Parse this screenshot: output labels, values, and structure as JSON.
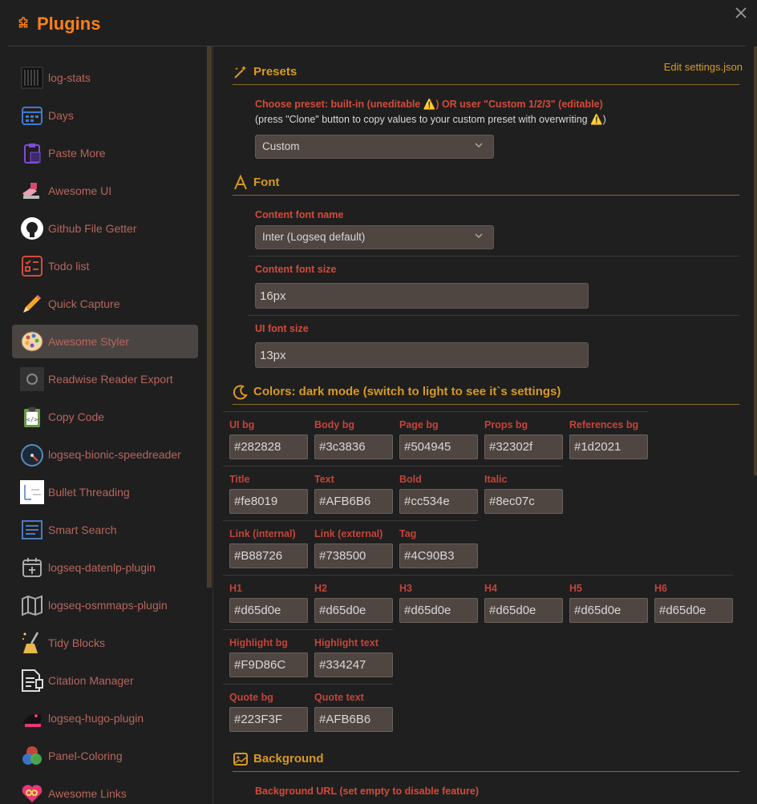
{
  "header": {
    "title": "Plugins",
    "title_icon": "puzzle-icon",
    "close_icon": "close-icon"
  },
  "sidebar": {
    "items": [
      {
        "label": "log-stats",
        "icon": "log-stats-icon"
      },
      {
        "label": "Days",
        "icon": "calendar-icon"
      },
      {
        "label": "Paste More",
        "icon": "paste-icon"
      },
      {
        "label": "Awesome UI",
        "icon": "awesome-ui-icon"
      },
      {
        "label": "Github File Getter",
        "icon": "github-icon"
      },
      {
        "label": "Todo list",
        "icon": "todo-list-icon"
      },
      {
        "label": "Quick Capture",
        "icon": "pencil-icon"
      },
      {
        "label": "Awesome Styler",
        "icon": "palette-icon"
      },
      {
        "label": "Readwise Reader Export",
        "icon": "readwise-icon"
      },
      {
        "label": "Copy Code",
        "icon": "clipboard-code-icon"
      },
      {
        "label": "logseq-bionic-speedreader",
        "icon": "speedometer-icon"
      },
      {
        "label": "Bullet Threading",
        "icon": "bullet-threading-icon"
      },
      {
        "label": "Smart Search",
        "icon": "smart-search-icon"
      },
      {
        "label": "logseq-datenlp-plugin",
        "icon": "calendar-plus-icon"
      },
      {
        "label": "logseq-osmmaps-plugin",
        "icon": "map-icon"
      },
      {
        "label": "Tidy Blocks",
        "icon": "broom-icon"
      },
      {
        "label": "Citation Manager",
        "icon": "citation-icon"
      },
      {
        "label": "logseq-hugo-plugin",
        "icon": "hugo-icon"
      },
      {
        "label": "Panel-Coloring",
        "icon": "color-circles-icon"
      },
      {
        "label": "Awesome Links",
        "icon": "heart-links-icon"
      }
    ]
  },
  "main": {
    "edit_settings": "Edit settings.json",
    "presets": {
      "title": "Presets",
      "label_a": "Choose preset: built-in (uneditable ",
      "label_b": ") OR user \"Custom 1/2/3\" (editable)",
      "desc_a": "(press \"Clone\" button to copy values to your custom preset with overwriting ",
      "desc_b": ")",
      "warning_glyph": "⚠️",
      "selected": "Custom"
    },
    "font": {
      "title": "Font",
      "content_font_name_label": "Content font name",
      "content_font_name_value": "Inter (Logseq default)",
      "content_font_size_label": "Content font size",
      "content_font_size_value": "16px",
      "ui_font_size_label": "UI font size",
      "ui_font_size_value": "13px"
    },
    "colors": {
      "title": "Colors: dark mode (switch to light to see it`s settings)",
      "ui_bg": {
        "label": "UI bg",
        "value": "#282828"
      },
      "body_bg": {
        "label": "Body bg",
        "value": "#3c3836"
      },
      "page_bg": {
        "label": "Page bg",
        "value": "#504945"
      },
      "props_bg": {
        "label": "Props bg",
        "value": "#32302f"
      },
      "references_bg": {
        "label": "References bg",
        "value": "#1d2021"
      },
      "title_c": {
        "label": "Title",
        "value": "#fe8019"
      },
      "text_c": {
        "label": "Text",
        "value": "#AFB6B6"
      },
      "bold_c": {
        "label": "Bold",
        "value": "#cc534e"
      },
      "italic_c": {
        "label": "Italic",
        "value": "#8ec07c"
      },
      "link_int": {
        "label": "Link (internal)",
        "value": "#B88726"
      },
      "link_ext": {
        "label": "Link (external)",
        "value": "#738500"
      },
      "tag": {
        "label": "Tag",
        "value": "#4C90B3"
      },
      "h1": {
        "label": "H1",
        "value": "#d65d0e"
      },
      "h2": {
        "label": "H2",
        "value": "#d65d0e"
      },
      "h3": {
        "label": "H3",
        "value": "#d65d0e"
      },
      "h4": {
        "label": "H4",
        "value": "#d65d0e"
      },
      "h5": {
        "label": "H5",
        "value": "#d65d0e"
      },
      "h6": {
        "label": "H6",
        "value": "#d65d0e"
      },
      "highlight_bg": {
        "label": "Highlight bg",
        "value": "#F9D86C"
      },
      "highlight_text": {
        "label": "Highlight text",
        "value": "#334247"
      },
      "quote_bg": {
        "label": "Quote bg",
        "value": "#223F3F"
      },
      "quote_text": {
        "label": "Quote text",
        "value": "#AFB6B6"
      }
    },
    "background": {
      "title": "Background",
      "url_label": "Background URL (set empty to disable feature)"
    }
  },
  "colors": {
    "accent": "#fe8019",
    "section": "#d79921",
    "label": "#d34b3b",
    "sidebar_text": "#b8655d"
  }
}
